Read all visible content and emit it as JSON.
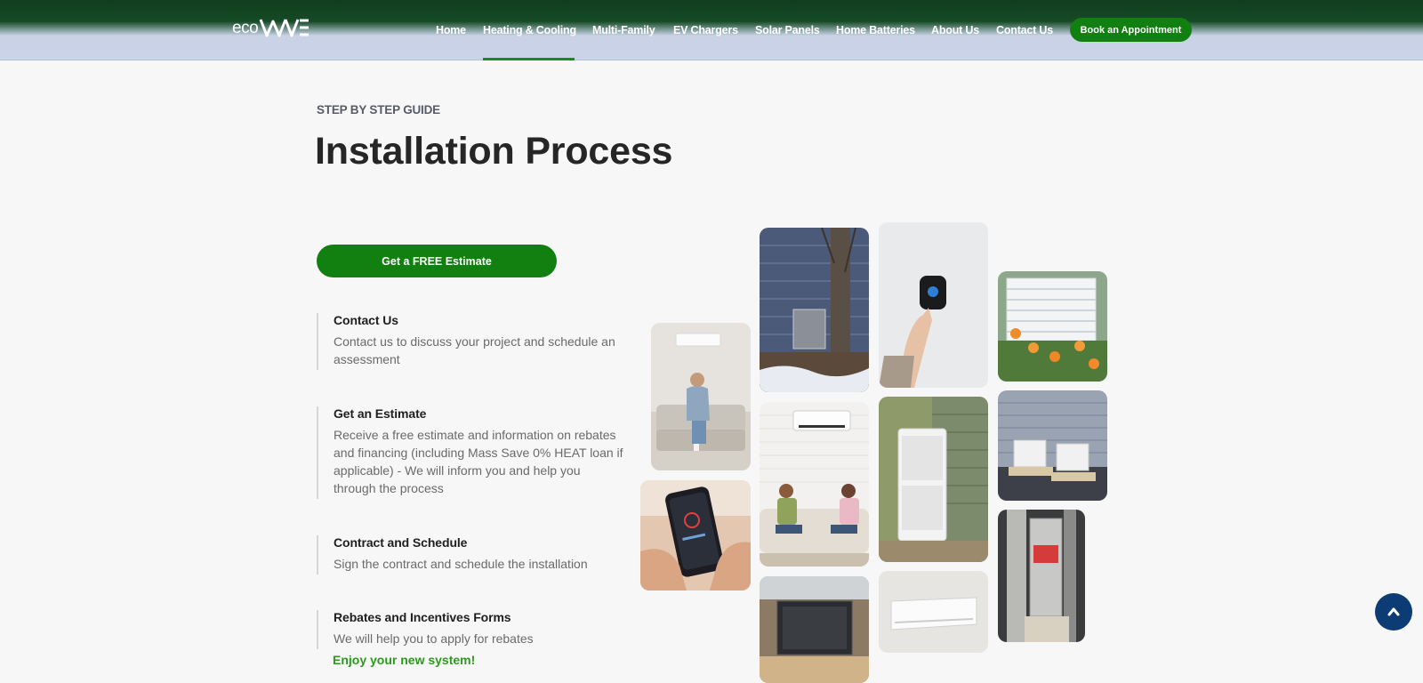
{
  "brand": {
    "prefix": "eco",
    "name_icon": "wave-logo-icon"
  },
  "nav": {
    "items": [
      {
        "label": "Home"
      },
      {
        "label": "Heating & Cooling",
        "active": true
      },
      {
        "label": "Multi-Family"
      },
      {
        "label": "EV Chargers"
      },
      {
        "label": "Solar Panels"
      },
      {
        "label": "Home Batteries"
      },
      {
        "label": "About Us"
      },
      {
        "label": "Contact Us"
      }
    ],
    "cta": "Book an Appointment"
  },
  "section": {
    "eyebrow": "STEP BY STEP GUIDE",
    "title": "Installation Process",
    "cta": "Get a FREE Estimate",
    "steps": [
      {
        "title": "Contact Us",
        "desc": "Contact us to discuss your project and schedule an assessment"
      },
      {
        "title": "Get an Estimate",
        "desc": "Receive a free estimate and information on rebates and financing (including Mass Save 0% HEAT loan if applicable) - We will inform you and help you through the process"
      },
      {
        "title": "Contract and Schedule",
        "desc": "Sign the contract and schedule the installation"
      },
      {
        "title": "Rebates and Incentives Forms",
        "desc": "We will help you to apply for rebates"
      }
    ],
    "closing": "Enjoy your new system!"
  },
  "gallery": [
    "woman-on-sofa-with-mini-split-photo",
    "phone-thermostat-app-photo",
    "outdoor-condenser-in-snow-photo",
    "family-with-wall-unit-photo",
    "air-handler-install-photo",
    "hand-on-thermostat-photo",
    "outdoor-heat-pump-units-photo",
    "white-wall-unit-photo",
    "outdoor-unit-with-flowers-photo",
    "two-outdoor-units-photo",
    "basement-air-handler-photo"
  ],
  "colors": {
    "brand_green": "#118011",
    "header_dark": "#103d1f",
    "scroll_top": "#0d3b73"
  },
  "scroll_top_icon": "chevron-up-icon"
}
